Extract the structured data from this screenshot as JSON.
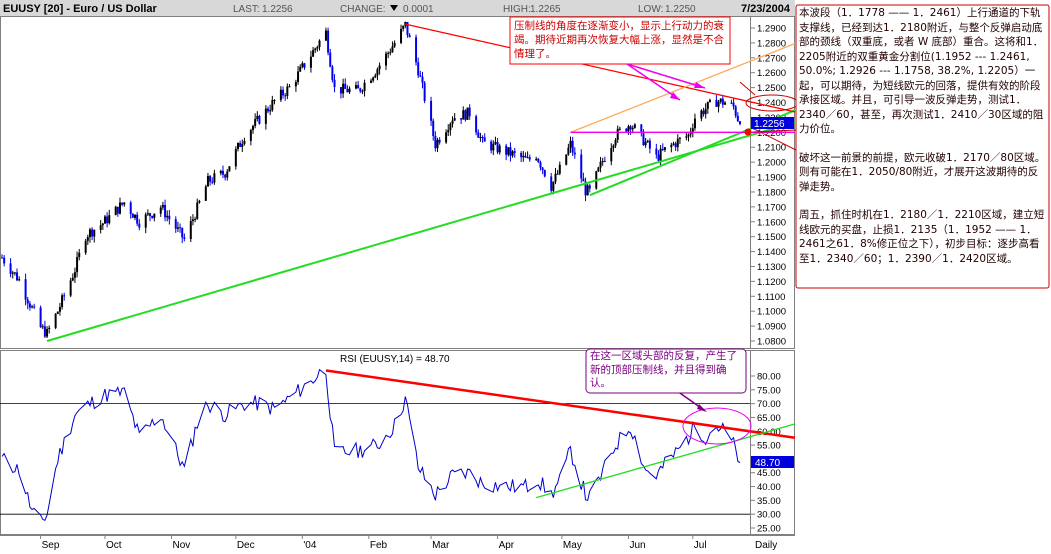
{
  "header": {
    "symbol": "EUUSY [20] - Euro / US Dollar",
    "last_label": "LAST:",
    "last_value": "1.2256",
    "change_label": "CHANGE:",
    "change_value": "0.0001",
    "high_label": "HIGH:",
    "high_value": "1.2265",
    "low_label": "LOW:",
    "low_value": "1.2250",
    "date": "7/23/2004"
  },
  "price_panel": {
    "y_ticks": [
      "1.2900",
      "1.2800",
      "1.2700",
      "1.2600",
      "1.2500",
      "1.2400",
      "1.2300",
      "1.2200",
      "1.2100",
      "1.2000",
      "1.1900",
      "1.1800",
      "1.1700",
      "1.1600",
      "1.1500",
      "1.1400",
      "1.1300",
      "1.1200",
      "1.1100",
      "1.1000",
      "1.0900",
      "1.0800"
    ],
    "last_price_tag": "1.2256"
  },
  "rsi_panel": {
    "title": "RSI (EUUSY,14) = 48.70",
    "y_ticks": [
      "80.00",
      "75.00",
      "70.00",
      "65.00",
      "60.00",
      "55.00",
      "50.00",
      "45.00",
      "40.00",
      "35.00",
      "30.00",
      "25.00"
    ],
    "rsi_tag": "48.70"
  },
  "x_axis": {
    "labels": [
      "Sep",
      "Oct",
      "Nov",
      "Dec",
      "'04",
      "Feb",
      "Mar",
      "Apr",
      "May",
      "Jun",
      "Jul",
      "Daily"
    ]
  },
  "annotations": {
    "price_note": "压制线的角度在逐渐变小，显示上行动力的衰竭。期待近期再次恢复大幅上涨，显然是不合情理了。",
    "rsi_note": "在这一区域头部的反复，产生了新的顶部压制线，并且得到确认。",
    "side_p1": "本波段（1．1778 —— 1．2461）上行通道的下轨支撑线，已经到达1．2180附近，与整个反弹启动底部的颈线（双重底，或者 W 底部）重合。这将和1．2205附近的双重黄金分割位(1.1952 --- 1.2461, 50.0%; 1.2926 --- 1.1758, 38.2%, 1.2205）一起，可以期待，为短线欧元的回落，提供有效的阶段承接区域。并且，可引导一波反弹走势，测试1．2340／60，甚至，再次测试1．2410／30区域的阻力价位。",
    "side_p2": "破坏这一前景的前提，欧元收破1．2170／80区域。则有可能在1．2050/80附近，才展开这波期待的反弹走势。",
    "side_p3": "周五，抓住时机在1．2180／1．2210区域，建立短线欧元的买盘，止损1．2135（1．1952 —— 1．2461之61．8%修正位之下），初步目标：逐步高看至1．2340／60；1．2390／1．2420区域。"
  },
  "colors": {
    "candle_up": "#000000",
    "candle_down": "#0000ee",
    "trend_green": "#22dd22",
    "resistance_red": "#ff0000",
    "channel_orange": "#ffaa55",
    "magenta": "#ee00ee",
    "ellipse_red": "#cc0000",
    "rsi_line": "#0000cc",
    "tag_blue": "#0000dd"
  },
  "chart_data": [
    {
      "type": "candlestick",
      "title": "EUUSY [20] - Euro / US Dollar",
      "xlabel": "",
      "ylabel": "",
      "ylim": [
        1.075,
        1.2965
      ],
      "x_range": [
        "2003-08-14",
        "2004-07-23"
      ],
      "anchors": [
        [
          "2003-08-14",
          1.136
        ],
        [
          "2003-08-22",
          1.121
        ],
        [
          "2003-09-01",
          1.089
        ],
        [
          "2003-09-04",
          1.085
        ],
        [
          "2003-09-09",
          1.1
        ],
        [
          "2003-09-17",
          1.128
        ],
        [
          "2003-09-22",
          1.151
        ],
        [
          "2003-09-30",
          1.159
        ],
        [
          "2003-10-10",
          1.173
        ],
        [
          "2003-10-17",
          1.16
        ],
        [
          "2003-10-27",
          1.17
        ],
        [
          "2003-11-07",
          1.148
        ],
        [
          "2003-11-13",
          1.169
        ],
        [
          "2003-11-18",
          1.187
        ],
        [
          "2003-11-26",
          1.193
        ],
        [
          "2003-12-05",
          1.218
        ],
        [
          "2003-12-12",
          1.229
        ],
        [
          "2003-12-19",
          1.241
        ],
        [
          "2003-12-26",
          1.25
        ],
        [
          "2004-01-05",
          1.272
        ],
        [
          "2004-01-09",
          1.281
        ],
        [
          "2004-01-12",
          1.287
        ],
        [
          "2004-01-16",
          1.249
        ],
        [
          "2004-01-27",
          1.248
        ],
        [
          "2004-02-05",
          1.263
        ],
        [
          "2004-02-13",
          1.28
        ],
        [
          "2004-02-18",
          1.292
        ],
        [
          "2004-02-24",
          1.262
        ],
        [
          "2004-03-03",
          1.212
        ],
        [
          "2004-03-11",
          1.23
        ],
        [
          "2004-03-19",
          1.233
        ],
        [
          "2004-03-25",
          1.213
        ],
        [
          "2004-04-05",
          1.207
        ],
        [
          "2004-04-15",
          1.201
        ],
        [
          "2004-04-19",
          1.205
        ],
        [
          "2004-04-26",
          1.184
        ],
        [
          "2004-04-30",
          1.195
        ],
        [
          "2004-05-05",
          1.212
        ],
        [
          "2004-05-12",
          1.181
        ],
        [
          "2004-05-14",
          1.18
        ],
        [
          "2004-05-20",
          1.201
        ],
        [
          "2004-05-26",
          1.218
        ],
        [
          "2004-06-02",
          1.226
        ],
        [
          "2004-06-09",
          1.213
        ],
        [
          "2004-06-14",
          1.203
        ],
        [
          "2004-06-18",
          1.208
        ],
        [
          "2004-06-24",
          1.214
        ],
        [
          "2004-06-29",
          1.218
        ],
        [
          "2004-07-02",
          1.23
        ],
        [
          "2004-07-07",
          1.236
        ],
        [
          "2004-07-12",
          1.241
        ],
        [
          "2004-07-16",
          1.24
        ],
        [
          "2004-07-20",
          1.237
        ],
        [
          "2004-07-23",
          1.2256
        ]
      ],
      "last": 1.2256,
      "high": 1.2265,
      "low": 1.225,
      "lines": [
        {
          "name": "",
          "color": "#22dd22",
          "from": [
            "2003-09-04",
            1.08
          ],
          "to": [
            "2004-07-23",
            1.216
          ]
        },
        {
          "name": "",
          "color": "#22dd22",
          "from": [
            "2004-05-14",
            1.1778
          ],
          "to": [
            "2004-07-23",
            1.2195
          ]
        },
        {
          "name": "",
          "color": "#ff0000",
          "from": [
            "2004-02-18",
            1.2926
          ],
          "to": [
            "2004-07-23",
            1.242
          ]
        },
        {
          "name": "",
          "color": "#ffaa55",
          "from": [
            "2004-05-05",
            1.22
          ],
          "to": [
            "2004-07-23",
            1.265
          ]
        },
        {
          "name": "",
          "color": "#ee00ee",
          "from": [
            "2004-05-05",
            1.22
          ],
          "to": [
            "2004-07-23",
            1.22
          ]
        }
      ]
    },
    {
      "type": "line",
      "title": "RSI (EUUSY,14) = 48.70",
      "ylim": [
        22,
        84
      ],
      "levels": [
        70,
        30
      ],
      "anchors": [
        [
          "2003-08-14",
          50
        ],
        [
          "2003-08-22",
          46
        ],
        [
          "2003-08-28",
          31
        ],
        [
          "2003-09-01",
          27
        ],
        [
          "2003-09-04",
          30
        ],
        [
          "2003-09-09",
          50
        ],
        [
          "2003-09-17",
          66
        ],
        [
          "2003-09-22",
          69
        ],
        [
          "2003-09-30",
          73
        ],
        [
          "2003-10-10",
          74
        ],
        [
          "2003-10-17",
          58
        ],
        [
          "2003-10-27",
          66
        ],
        [
          "2003-11-07",
          46
        ],
        [
          "2003-11-13",
          63
        ],
        [
          "2003-11-18",
          70
        ],
        [
          "2003-11-26",
          66
        ],
        [
          "2003-12-05",
          70
        ],
        [
          "2003-12-12",
          70
        ],
        [
          "2003-12-19",
          68
        ],
        [
          "2003-12-26",
          72
        ],
        [
          "2004-01-05",
          78
        ],
        [
          "2004-01-09",
          81
        ],
        [
          "2004-01-12",
          82
        ],
        [
          "2004-01-16",
          52
        ],
        [
          "2004-01-27",
          53
        ],
        [
          "2004-02-05",
          55
        ],
        [
          "2004-02-13",
          62
        ],
        [
          "2004-02-18",
          72
        ],
        [
          "2004-02-24",
          47
        ],
        [
          "2004-03-03",
          37
        ],
        [
          "2004-03-11",
          44
        ],
        [
          "2004-03-19",
          45
        ],
        [
          "2004-03-25",
          41
        ],
        [
          "2004-04-05",
          40
        ],
        [
          "2004-04-15",
          40
        ],
        [
          "2004-04-19",
          43
        ],
        [
          "2004-04-26",
          37
        ],
        [
          "2004-04-30",
          42
        ],
        [
          "2004-05-05",
          53
        ],
        [
          "2004-05-12",
          37
        ],
        [
          "2004-05-14",
          36
        ],
        [
          "2004-05-20",
          45
        ],
        [
          "2004-05-26",
          55
        ],
        [
          "2004-06-02",
          62
        ],
        [
          "2004-06-09",
          46
        ],
        [
          "2004-06-14",
          44
        ],
        [
          "2004-06-18",
          48
        ],
        [
          "2004-06-24",
          53
        ],
        [
          "2004-06-29",
          58
        ],
        [
          "2004-07-02",
          62
        ],
        [
          "2004-07-07",
          58
        ],
        [
          "2004-07-12",
          62
        ],
        [
          "2004-07-16",
          60
        ],
        [
          "2004-07-20",
          55
        ],
        [
          "2004-07-23",
          48.7
        ]
      ],
      "lines": [
        {
          "name": "",
          "color": "#ff0000",
          "from": [
            "2004-01-12",
            82
          ],
          "to": [
            "2004-07-23",
            60.5
          ]
        },
        {
          "name": "",
          "color": "#22dd22",
          "from": [
            "2004-04-19",
            36
          ],
          "to": [
            "2004-07-23",
            57
          ]
        }
      ]
    }
  ]
}
